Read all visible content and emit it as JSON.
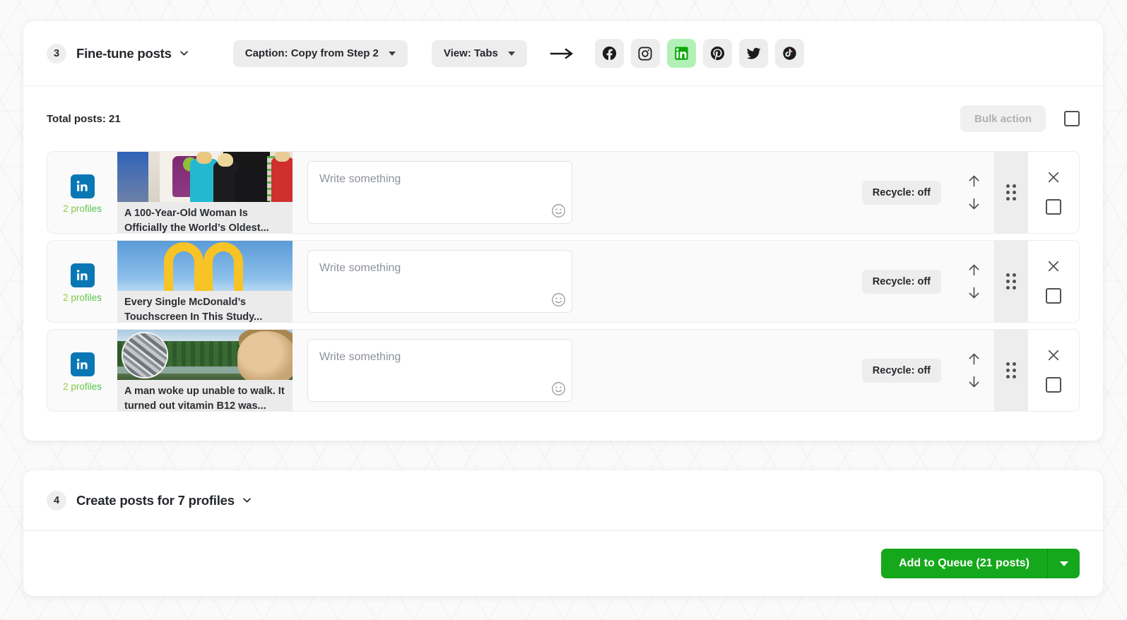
{
  "step3": {
    "badge": "3",
    "title": "Fine-tune posts",
    "caption_pill": "Caption: Copy from Step 2",
    "view_pill": "View: Tabs",
    "arrow_icon": "arrow-right-icon",
    "networks": [
      {
        "name": "facebook",
        "icon": "facebook-icon",
        "active": false
      },
      {
        "name": "instagram",
        "icon": "instagram-icon",
        "active": false
      },
      {
        "name": "linkedin",
        "icon": "linkedin-icon",
        "active": true
      },
      {
        "name": "pinterest",
        "icon": "pinterest-icon",
        "active": false
      },
      {
        "name": "twitter",
        "icon": "twitter-icon",
        "active": false
      },
      {
        "name": "tiktok",
        "icon": "tiktok-icon",
        "active": false
      }
    ]
  },
  "toolbar": {
    "total_posts": "Total posts: 21",
    "bulk_action": "Bulk action",
    "select_all_checkbox": "select-all-checkbox"
  },
  "posts": [
    {
      "network": "linkedin",
      "profiles": "2 profiles",
      "title": "A 100-Year-Old Woman Is Officially the World’s Oldest...",
      "compose_value": "",
      "compose_placeholder": "Write something",
      "recycle": "Recycle: off",
      "art": "art-gym"
    },
    {
      "network": "linkedin",
      "profiles": "2 profiles",
      "title": "Every Single McDonald’s Touchscreen In This Study...",
      "compose_value": "",
      "compose_placeholder": "Write something",
      "recycle": "Recycle: off",
      "art": "art-mcd"
    },
    {
      "network": "linkedin",
      "profiles": "2 profiles",
      "title": "A man woke up unable to walk. It turned out vitamin B12 was...",
      "compose_value": "",
      "compose_placeholder": "Write something",
      "recycle": "Recycle: off",
      "art": "art-lake"
    }
  ],
  "step4": {
    "badge": "4",
    "title": "Create posts for 7 profiles"
  },
  "footer": {
    "queue_button": "Add to Queue (21 posts)",
    "queue_caret": "chevron-down-icon"
  },
  "colors": {
    "accent_green": "#16a81c",
    "active_network_bg": "#b3f0b8",
    "linkedin_blue": "#0a77b5",
    "pill_bg": "#ededed"
  }
}
